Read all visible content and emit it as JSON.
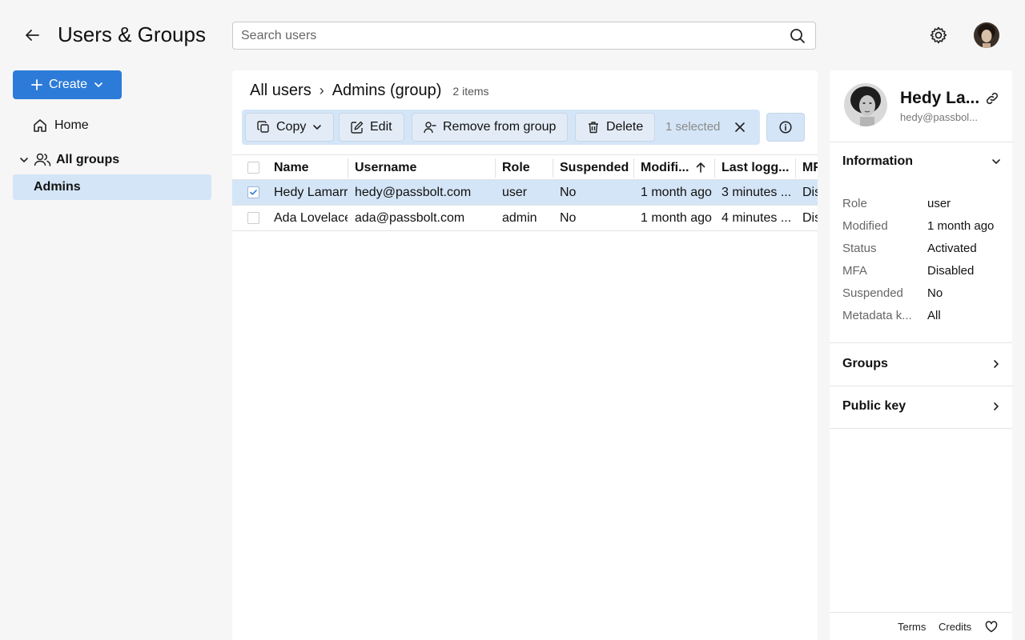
{
  "header": {
    "title": "Users & Groups",
    "search_placeholder": "Search users",
    "back_icon": "arrow-left-icon",
    "settings_icon": "gear-icon"
  },
  "sidebar": {
    "create_label": "Create",
    "home_label": "Home",
    "groups_label": "All groups",
    "groups": [
      {
        "label": "Admins",
        "selected": true
      }
    ]
  },
  "breadcrumb": {
    "root": "All users",
    "separator": "›",
    "current": "Admins (group)",
    "count": "2 items"
  },
  "toolbar": {
    "copy_label": "Copy",
    "edit_label": "Edit",
    "remove_label": "Remove from group",
    "delete_label": "Delete",
    "selected_text": "1 selected"
  },
  "table": {
    "columns": [
      "Name",
      "Username",
      "Role",
      "Suspended",
      "Modifi...",
      "Last logg...",
      "MFA"
    ],
    "sort_column": "Modifi...",
    "rows": [
      {
        "name": "Hedy Lamarr",
        "username": "hedy@passbolt.com",
        "role": "user",
        "suspended": "No",
        "modified": "1 month ago",
        "last_logged": "3 minutes ...",
        "mfa": "Disabled",
        "selected": true
      },
      {
        "name": "Ada Lovelace",
        "username": "ada@passbolt.com",
        "role": "admin",
        "suspended": "No",
        "modified": "1 month ago",
        "last_logged": "4 minutes ...",
        "mfa": "Disabled",
        "selected": false
      }
    ]
  },
  "details": {
    "name": "Hedy La...",
    "email": "hedy@passbol...",
    "information_label": "Information",
    "fields": [
      {
        "label": "Role",
        "value": "user"
      },
      {
        "label": "Modified",
        "value": "1 month ago"
      },
      {
        "label": "Status",
        "value": "Activated"
      },
      {
        "label": "MFA",
        "value": "Disabled"
      },
      {
        "label": "Suspended",
        "value": "No"
      },
      {
        "label": "Metadata k...",
        "value": "All"
      }
    ],
    "groups_label": "Groups",
    "public_key_label": "Public key"
  },
  "footer": {
    "terms": "Terms",
    "credits": "Credits"
  },
  "colors": {
    "accent": "#2d7bd8",
    "selection": "#d4e5f7",
    "background": "#f6f6f6"
  }
}
